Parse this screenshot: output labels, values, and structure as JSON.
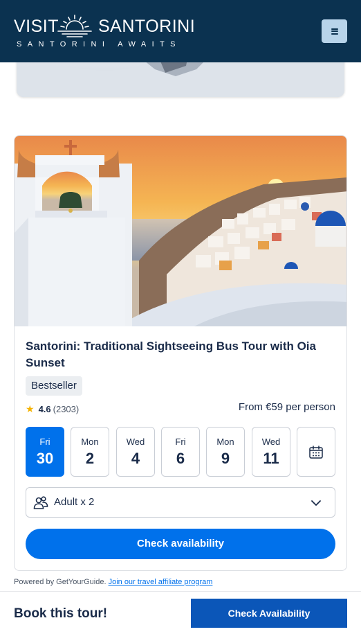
{
  "header": {
    "logo_word_1": "VISIT",
    "logo_word_2": "SANTORINI",
    "tagline": "SANTORINI AWAITS",
    "menu_icon": "hamburger-icon",
    "bg_color": "#0b3250"
  },
  "tour": {
    "title": "Santorini: Traditional Sightseeing Bus Tour with Oia Sunset",
    "badge": "Bestseller",
    "rating": {
      "score": "4.6",
      "count": "(2303)"
    },
    "price": "From €59 per person",
    "dates": [
      {
        "dow": "Fri",
        "day": "30",
        "selected": true
      },
      {
        "dow": "Mon",
        "day": "2",
        "selected": false
      },
      {
        "dow": "Wed",
        "day": "4",
        "selected": false
      },
      {
        "dow": "Fri",
        "day": "6",
        "selected": false
      },
      {
        "dow": "Mon",
        "day": "9",
        "selected": false
      },
      {
        "dow": "Wed",
        "day": "11",
        "selected": false
      }
    ],
    "calendar_icon": "calendar-icon",
    "travellers": "Adult x 2",
    "check_availability": "Check availability"
  },
  "footer": {
    "powered_by": "Powered by GetYourGuide.",
    "affiliate_link": "Join our travel affiliate program"
  },
  "bottom_bar": {
    "label": "Book this tour!",
    "button": "Check Availability"
  },
  "colors": {
    "accent": "#0071eb",
    "navy": "#0b3250",
    "star": "#f5b300"
  }
}
